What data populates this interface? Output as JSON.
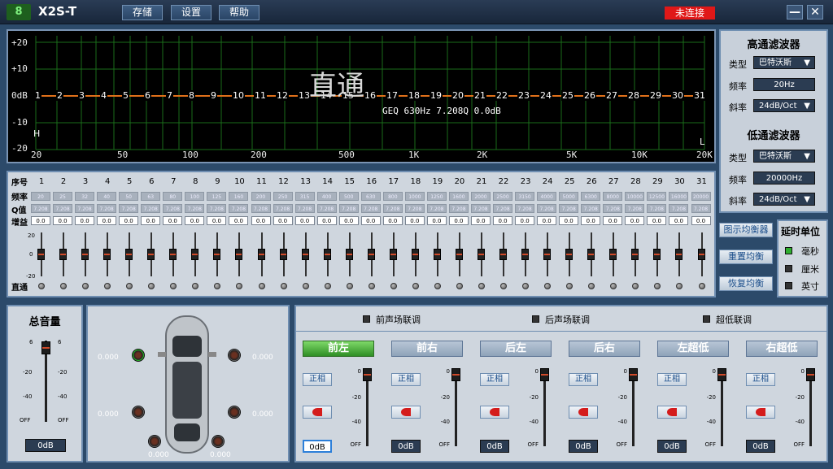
{
  "titlebar": {
    "logo": "8",
    "app_title": "X2S-T",
    "menu": [
      "存储",
      "设置",
      "帮助"
    ],
    "status": "未连接",
    "minimize": "—",
    "close": "✕"
  },
  "graph": {
    "ylabels": [
      "+20",
      "+10",
      "0dB",
      "-10",
      "-20"
    ],
    "xlabels": [
      "20",
      "50",
      "100",
      "200",
      "500",
      "1K",
      "2K",
      "5K",
      "10K",
      "20K"
    ],
    "band_numbers": [
      "1",
      "2",
      "3",
      "4",
      "5",
      "6",
      "7",
      "8",
      "9",
      "10",
      "11",
      "12",
      "13",
      "14",
      "15",
      "16",
      "17",
      "18",
      "19",
      "20",
      "21",
      "22",
      "23",
      "24",
      "25",
      "26",
      "27",
      "28",
      "29",
      "30",
      "31"
    ],
    "mode_watermark": "直通",
    "readout": "GEQ 630Hz 7.208Q 0.0dB",
    "h_label": "H",
    "l_label": "L"
  },
  "filters": {
    "highpass": {
      "title": "高通滤波器",
      "type_label": "类型",
      "type": "巴特沃斯",
      "freq_label": "频率",
      "freq": "20Hz",
      "slope_label": "斜率",
      "slope": "24dB/Oct"
    },
    "lowpass": {
      "title": "低通滤波器",
      "type_label": "类型",
      "type": "巴特沃斯",
      "freq_label": "频率",
      "freq": "20000Hz",
      "slope_label": "斜率",
      "slope": "24dB/Oct"
    }
  },
  "eq": {
    "row_labels": {
      "index": "序号",
      "freq": "频率",
      "q": "Q值",
      "gain": "增益",
      "bypass": "直通"
    },
    "bands": [
      "1",
      "2",
      "3",
      "4",
      "5",
      "6",
      "7",
      "8",
      "9",
      "10",
      "11",
      "12",
      "13",
      "14",
      "15",
      "16",
      "17",
      "18",
      "19",
      "20",
      "21",
      "22",
      "23",
      "24",
      "25",
      "26",
      "27",
      "28",
      "29",
      "30",
      "31"
    ],
    "freqs": [
      "20",
      "25",
      "32",
      "40",
      "50",
      "63",
      "80",
      "100",
      "125",
      "160",
      "200",
      "250",
      "315",
      "400",
      "500",
      "630",
      "800",
      "1000",
      "1250",
      "1600",
      "2000",
      "2500",
      "3150",
      "4000",
      "5000",
      "6300",
      "8000",
      "10000",
      "12500",
      "16000",
      "20000"
    ],
    "q": "7.208",
    "gain": "0.0",
    "scale": [
      "20",
      "0",
      "-20"
    ]
  },
  "side_buttons": [
    "图示均衡器",
    "重置均衡",
    "恢复均衡"
  ],
  "delay": {
    "title": "延时单位",
    "options": [
      "毫秒",
      "厘米",
      "英寸"
    ],
    "selected_color": "#2fae2f"
  },
  "volume": {
    "title": "总音量",
    "value": "0dB",
    "scale_left": [
      "6",
      "-20",
      "-40",
      "OFF"
    ],
    "scale_right": [
      "6",
      "-20",
      "-40",
      "OFF"
    ]
  },
  "car": {
    "delays": {
      "fl": "0.000",
      "fr": "0.000",
      "rl": "0.000",
      "rr": "0.000",
      "sl": "0.000",
      "sr": "0.000"
    }
  },
  "links": {
    "front": "前声场联调",
    "rear": "后声场联调",
    "sub": "超低联调"
  },
  "channels": [
    {
      "name": "前左",
      "phase": "正相",
      "value": "0dB"
    },
    {
      "name": "前右",
      "phase": "正相",
      "value": "0dB"
    },
    {
      "name": "后左",
      "phase": "正相",
      "value": "0dB"
    },
    {
      "name": "后右",
      "phase": "正相",
      "value": "0dB"
    },
    {
      "name": "左超低",
      "phase": "正相",
      "value": "0dB"
    },
    {
      "name": "右超低",
      "phase": "正相",
      "value": "0dB"
    }
  ],
  "channel_scale": [
    "0",
    "-20",
    "-40",
    "OFF"
  ],
  "colors": {
    "accent_green": "#3cbf2c",
    "status_red": "#e01818",
    "graph_line": "#e0701a",
    "grid": "#1e7a1e"
  }
}
